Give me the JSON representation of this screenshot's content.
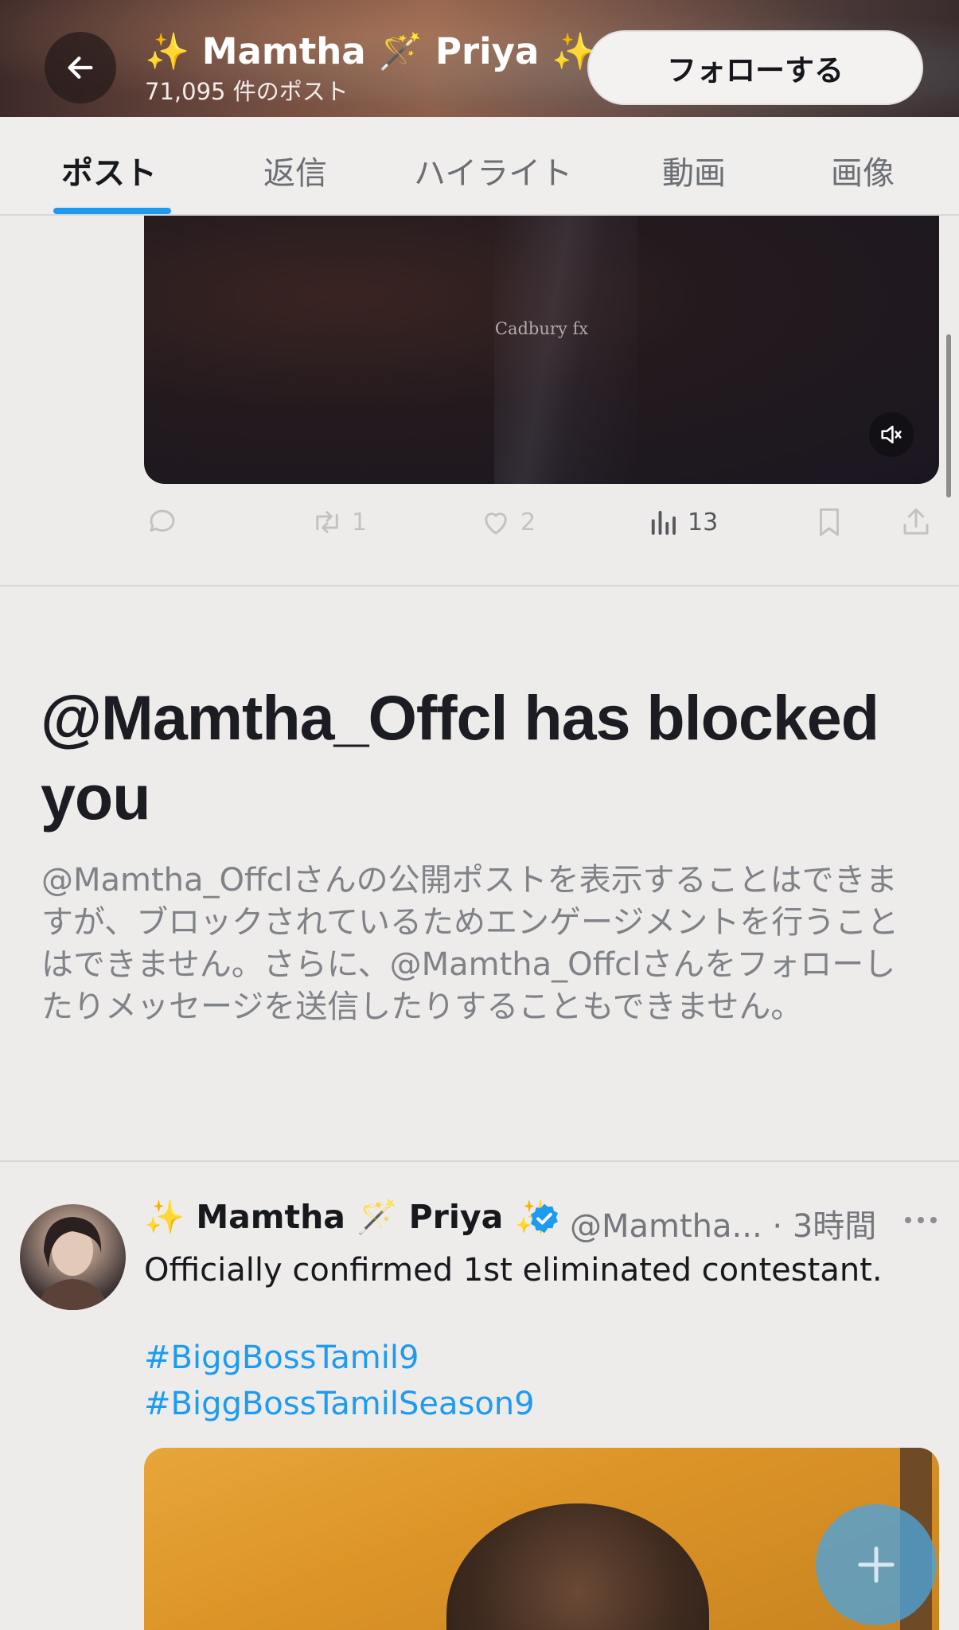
{
  "header": {
    "title": "✨ Mamtha 🪄 Priya ✨",
    "post_count": "71,095 件のポスト",
    "follow_label": "フォローする"
  },
  "tabs": [
    {
      "label": "ポスト",
      "active": true
    },
    {
      "label": "返信",
      "active": false
    },
    {
      "label": "ハイライト",
      "active": false
    },
    {
      "label": "動画",
      "active": false
    },
    {
      "label": "画像",
      "active": false
    }
  ],
  "video": {
    "caption": "Cadbury fx"
  },
  "actions": {
    "reposts": "1",
    "likes": "2",
    "views": "13"
  },
  "blocked": {
    "title": "@Mamtha_Offcl has blocked you",
    "body": "@Mamtha_Offclさんの公開ポストを表示することはできますが、ブロックされているためエンゲージメントを行うことはできません。さらに、@Mamtha_Offclさんをフォローしたりメッセージを送信したりすることもできません。"
  },
  "post": {
    "name": "✨ Mamtha 🪄 Priya ✨",
    "handle_time": "@Mamtha... · 3時間",
    "text": "Officially confirmed 1st eliminated contestant.",
    "hashtags": [
      "#BiggBossTamil9",
      "#BiggBossTamilSeason9"
    ]
  },
  "colors": {
    "accent": "#1d9bf0",
    "background": "#eeeceb"
  }
}
